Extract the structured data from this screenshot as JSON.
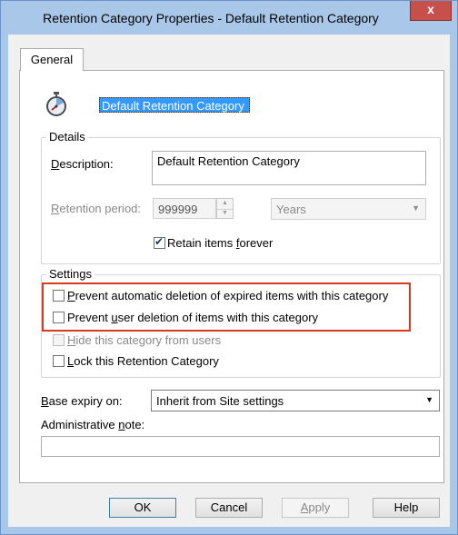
{
  "window": {
    "title": "Retention Category Properties - Default Retention Category",
    "close_glyph": "x"
  },
  "tabs": [
    {
      "label": "General"
    }
  ],
  "general": {
    "name_value": "Default Retention Category",
    "details": {
      "group_title": "Details",
      "description_label_prefix": "",
      "description_label_hot": "D",
      "description_label_rest": "escription:",
      "description_value": "Default Retention Category",
      "retention_label_hot": "R",
      "retention_label_rest": "etention period:",
      "retention_value": "999999",
      "retention_unit": "Years",
      "retain_forever_prefix": "Retain items ",
      "retain_forever_hot": "f",
      "retain_forever_rest": "orever",
      "retain_forever_checked": true
    },
    "settings": {
      "group_title": "Settings",
      "items": [
        {
          "hot": "P",
          "rest": "revent automatic deletion of expired items with this category",
          "checked": false,
          "enabled": true
        },
        {
          "prefix": "Prevent ",
          "hot": "u",
          "rest": "ser deletion of items with this category",
          "checked": false,
          "enabled": true
        },
        {
          "hot": "H",
          "rest": "ide this category from users",
          "checked": false,
          "enabled": false
        },
        {
          "hot": "L",
          "rest": "ock this Retention Category",
          "checked": false,
          "enabled": true
        }
      ]
    },
    "base_expiry": {
      "label_prefix": "",
      "label_hot": "B",
      "label_rest": "ase expiry on:",
      "value": "Inherit from Site settings"
    },
    "admin_note": {
      "label_prefix": "Administrative ",
      "label_hot": "n",
      "label_rest": "ote:",
      "value": ""
    }
  },
  "buttons": {
    "ok": "OK",
    "cancel": "Cancel",
    "apply_hot": "A",
    "apply_rest": "pply",
    "help": "Help"
  },
  "colors": {
    "highlight": "#d9391c",
    "selection": "#3399ff",
    "close": "#c7504a"
  }
}
